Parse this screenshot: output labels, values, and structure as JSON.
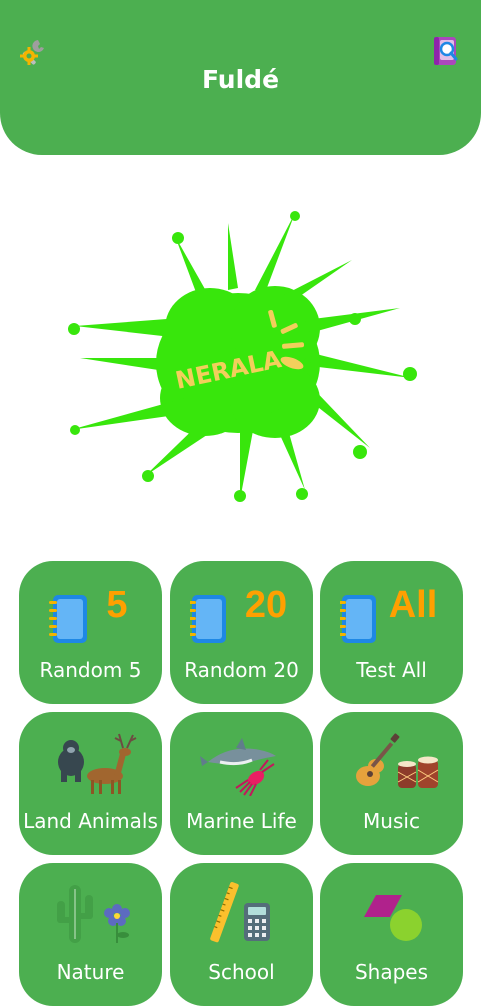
{
  "header": {
    "title": "Fuldé",
    "settings_icon": "tools-icon",
    "search_icon": "book-search-icon"
  },
  "logo": {
    "text": "NERALA",
    "splash_color": "#38e60c",
    "text_color": "#f2cf5c"
  },
  "colors": {
    "primary": "#4caf50",
    "accent": "#ffa000"
  },
  "tiles": [
    {
      "label": "Random 5",
      "badge": "5",
      "icon": "notebook-icon"
    },
    {
      "label": "Random 20",
      "badge": "20",
      "icon": "notebook-icon"
    },
    {
      "label": "Test All",
      "badge": "All",
      "icon": "notebook-icon"
    },
    {
      "label": "Land Animals",
      "icon": "gorilla-deer-icon"
    },
    {
      "label": "Marine Life",
      "icon": "dolphin-squid-icon"
    },
    {
      "label": "Music",
      "icon": "guitar-drums-icon"
    },
    {
      "label": "Nature",
      "icon": "cactus-flower-icon"
    },
    {
      "label": "School",
      "icon": "ruler-calculator-icon"
    },
    {
      "label": "Shapes",
      "icon": "parallelogram-circle-icon"
    }
  ]
}
